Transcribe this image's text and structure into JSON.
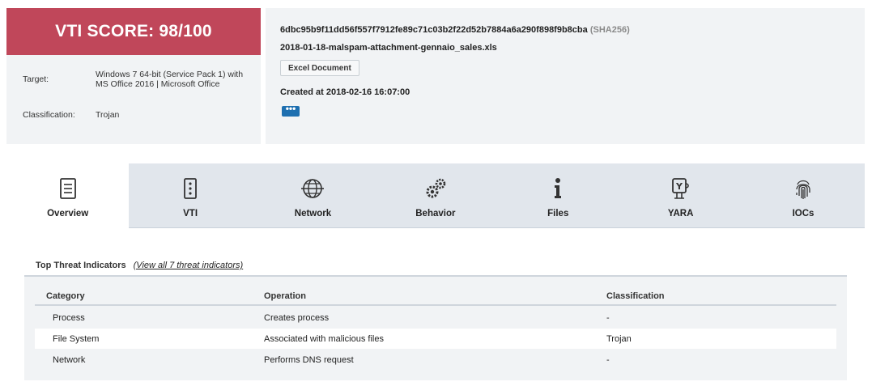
{
  "summary": {
    "score_text": "VTI SCORE: 98/100",
    "target_label": "Target:",
    "target_value": "Windows 7 64-bit (Service Pack 1) with MS Office 2016 | Microsoft Office",
    "classification_label": "Classification:",
    "classification_value": "Trojan",
    "score_color": "#c0475a"
  },
  "file": {
    "hash": "6dbc95b9f11dd56f557f7912fe89c71c03b2f22d52b7884a6a290f898f9b8cba",
    "hash_type": "(SHA256)",
    "name": "2018-01-18-malspam-attachment-gennaio_sales.xls",
    "tag": "Excel Document",
    "created": "Created at 2018-02-16 16:07:00",
    "more_label": "•••"
  },
  "tabs": [
    {
      "label": "Overview",
      "icon": "document-icon",
      "active": true
    },
    {
      "label": "VTI",
      "icon": "server-icon",
      "active": false
    },
    {
      "label": "Network",
      "icon": "globe-icon",
      "active": false
    },
    {
      "label": "Behavior",
      "icon": "gears-icon",
      "active": false
    },
    {
      "label": "Files",
      "icon": "info-icon",
      "active": false
    },
    {
      "label": "YARA",
      "icon": "yara-icon",
      "active": false
    },
    {
      "label": "IOCs",
      "icon": "fingerprint-icon",
      "active": false
    }
  ],
  "threats": {
    "title": "Top Threat Indicators",
    "link": "(View all 7 threat indicators)",
    "columns": [
      "Category",
      "Operation",
      "Classification"
    ],
    "rows": [
      [
        "Process",
        "Creates process",
        "-"
      ],
      [
        "File System",
        "Associated with malicious files",
        "Trojan"
      ],
      [
        "Network",
        "Performs DNS request",
        "-"
      ]
    ]
  }
}
